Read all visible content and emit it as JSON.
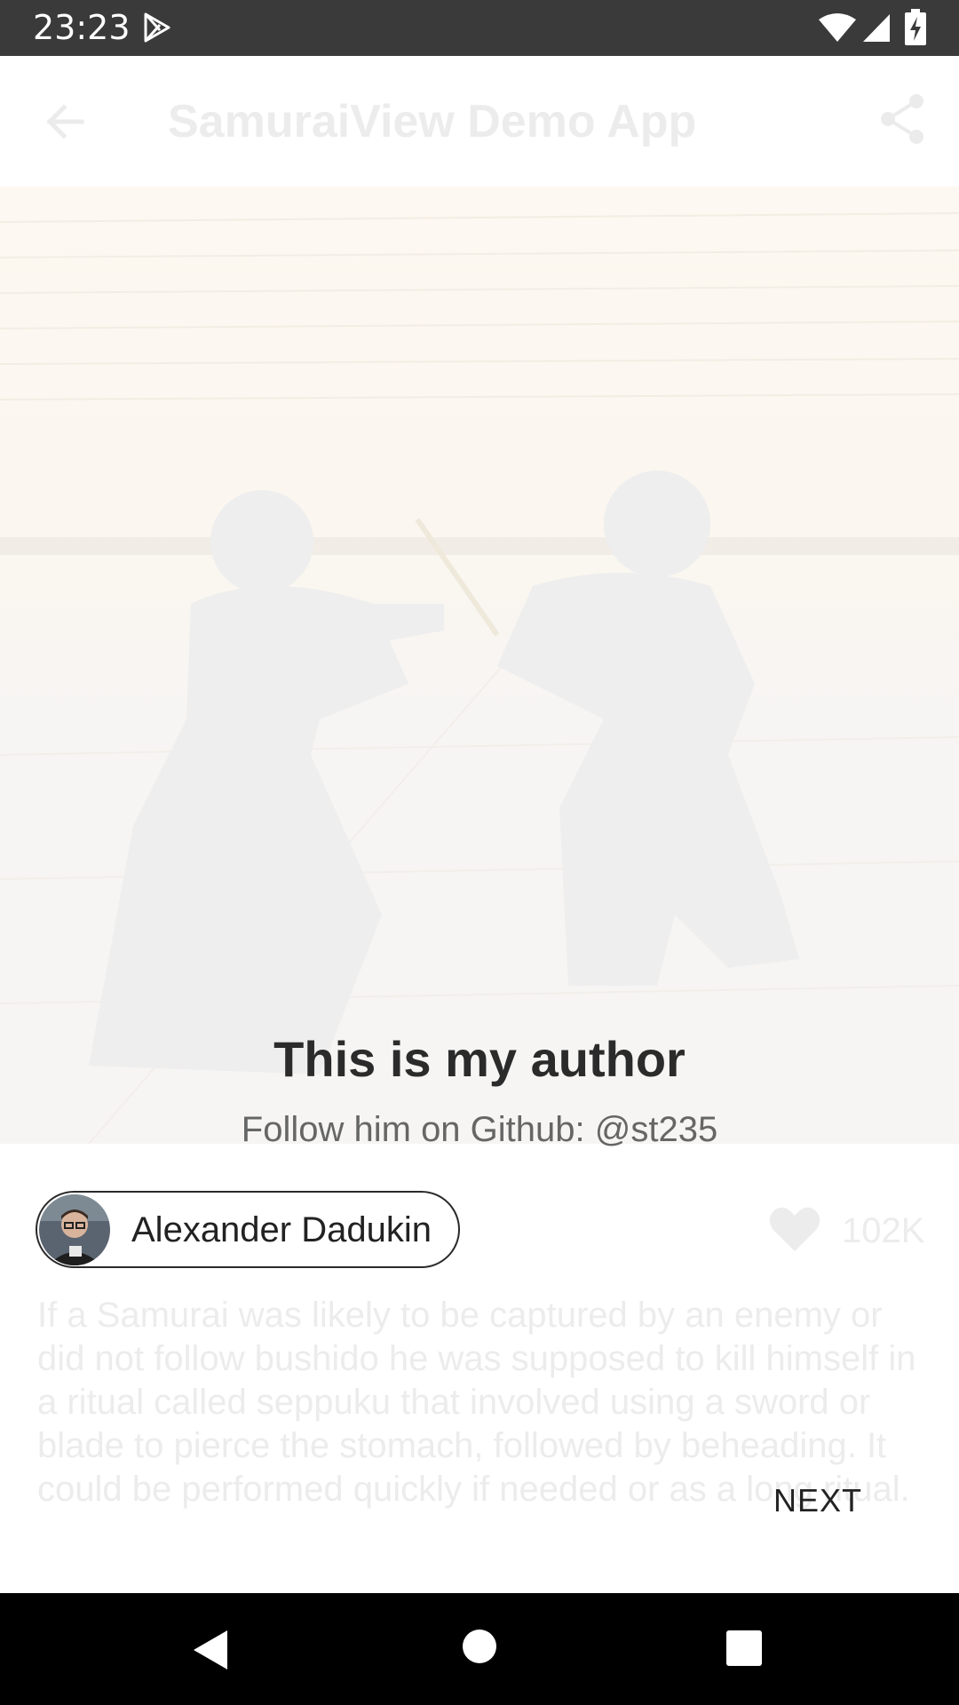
{
  "status_bar": {
    "time": "23:23",
    "icons": [
      "play-store-icon",
      "wifi-icon",
      "signal-icon",
      "battery-charging-icon"
    ],
    "background": "#3a3a3a"
  },
  "app_bar": {
    "title": "SamuraiView Demo App",
    "back_icon": "arrow-back-icon",
    "share_icon": "share-icon"
  },
  "onboarding": {
    "title": "This is my author",
    "subtitle": "Follow him on Github: @st235",
    "next_label": "NEXT"
  },
  "author": {
    "name": "Alexander Dadukin"
  },
  "likes": {
    "icon": "heart-icon",
    "count": "102K"
  },
  "description": "If a Samurai was likely to be captured by an enemy or did not follow bushido he was supposed to kill himself in a ritual called seppuku that involved using a sword or blade to pierce the stomach, followed by beheading. It could be performed quickly if needed or as a long ritual.",
  "nav_bar": {
    "icons": [
      "nav-back-icon",
      "nav-home-icon",
      "nav-recents-icon"
    ]
  }
}
